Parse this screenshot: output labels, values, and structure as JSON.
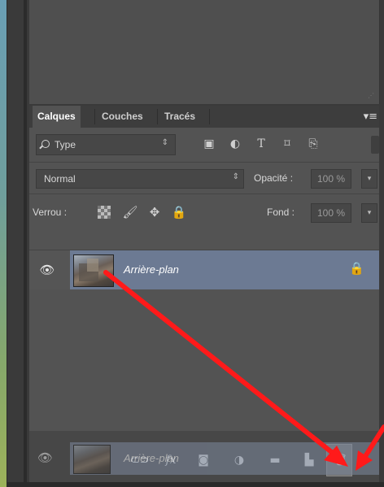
{
  "tabs": [
    {
      "label": "Calques",
      "active": true
    },
    {
      "label": "Couches",
      "active": false
    },
    {
      "label": "Tracés",
      "active": false
    }
  ],
  "filter": {
    "kind_label": "Type",
    "icons": [
      "image-filter-icon",
      "adjustment-filter-icon",
      "type-filter-icon",
      "shape-filter-icon",
      "smart-object-filter-icon"
    ]
  },
  "blend": {
    "mode_label": "Normal",
    "opacity_label": "Opacité :",
    "opacity_value": "100 %"
  },
  "lock": {
    "label": "Verrou :",
    "icons": [
      "lock-transparent-pixels-icon",
      "lock-image-pixels-icon",
      "lock-position-icon",
      "lock-all-icon"
    ],
    "fill_label": "Fond :",
    "fill_value": "100 %"
  },
  "layers": [
    {
      "name": "Arrière-plan",
      "visible": true,
      "locked": true,
      "selected": true
    }
  ],
  "drag_ghost": {
    "name": "Arrière-plan"
  },
  "bottom_icons": [
    "link-layers-icon",
    "layer-style-icon",
    "add-mask-icon",
    "new-adjustment-layer-icon",
    "new-group-icon",
    "new-layer-icon",
    "delete-layer-icon"
  ],
  "colors": {
    "annotation_arrow": "#ff1a1a",
    "selection": "#6c7a93",
    "panel": "#535353"
  }
}
